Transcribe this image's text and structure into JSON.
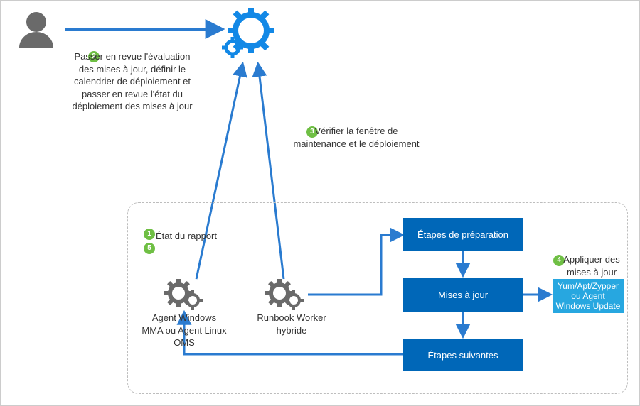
{
  "colors": {
    "accent_blue": "#0067b8",
    "cyan": "#27a7e0",
    "badge_green": "#6fbf44",
    "gear_gray": "#6a6a6a",
    "person_gray": "#6a6a6a",
    "border_gray": "#cccccc",
    "dash_gray": "#bdbdbd"
  },
  "badges": {
    "b1": "1",
    "b2": "2",
    "b3": "3",
    "b4": "4",
    "b5": "5"
  },
  "labels": {
    "step2": "Passer en revue l'évaluation des mises à jour, définir le calendrier de déploiement et passer en revue l'état du déploiement des mises à jour",
    "step3": "Vérifier la fenêtre de maintenance et le déploiement",
    "step1": "État du rapport",
    "step4": "Appliquer des mises à jour",
    "agent": "Agent Windows MMA ou Agent Linux OMS",
    "runbook": "Runbook Worker hybride",
    "prep": "Étapes de préparation",
    "updates": "Mises à jour",
    "after": "Étapes suivantes",
    "pkg": "Yum/Apt/Zypper ou Agent Windows Update"
  },
  "icons": {
    "user": "user-icon",
    "automation": "automation-gear-bolt-icon",
    "gears_agent": "gears-icon",
    "gears_runbook": "gears-icon"
  }
}
